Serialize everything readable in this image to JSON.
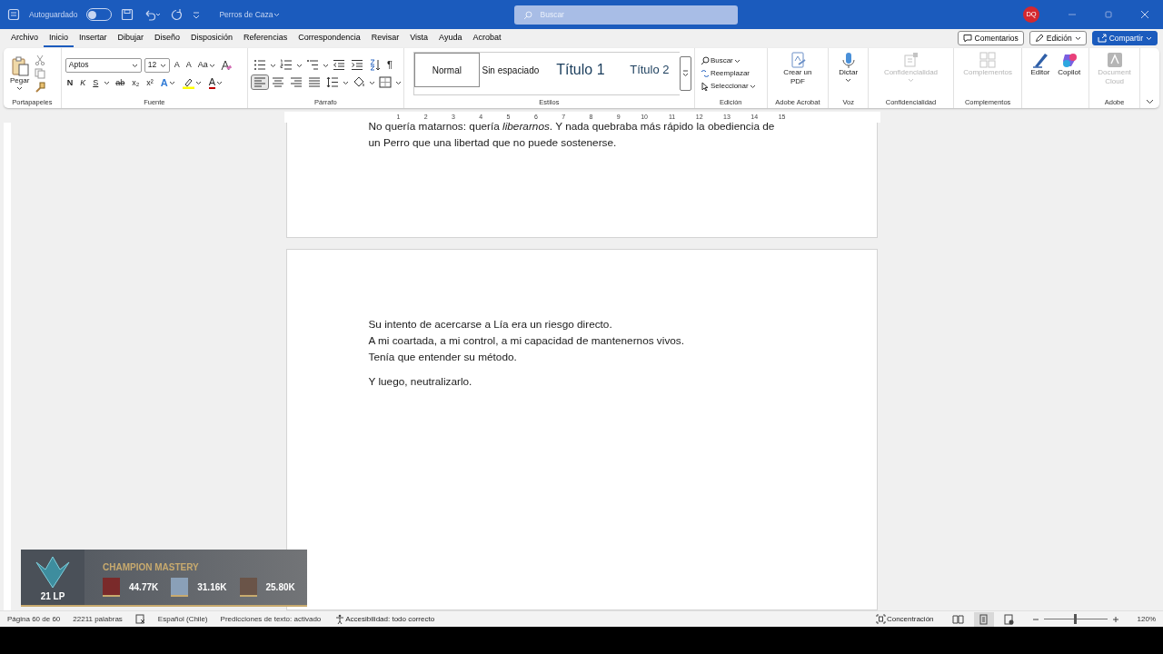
{
  "title_bar": {
    "autosave_label": "Autoguardado",
    "autosave_on": false,
    "document_title": "Perros de Caza",
    "search": {
      "placeholder": "Buscar"
    },
    "avatar": "DQ"
  },
  "menu_tabs": [
    {
      "label": "Archivo",
      "selected": false
    },
    {
      "label": "Inicio",
      "selected": true
    },
    {
      "label": "Insertar",
      "selected": false
    },
    {
      "label": "Dibujar",
      "selected": false
    },
    {
      "label": "Diseño",
      "selected": false
    },
    {
      "label": "Disposición",
      "selected": false
    },
    {
      "label": "Referencias",
      "selected": false
    },
    {
      "label": "Correspondencia",
      "selected": false
    },
    {
      "label": "Revisar",
      "selected": false
    },
    {
      "label": "Vista",
      "selected": false
    },
    {
      "label": "Ayuda",
      "selected": false
    },
    {
      "label": "Acrobat",
      "selected": false
    }
  ],
  "top_actions": [
    {
      "kind": "comments",
      "label": "Comentarios"
    },
    {
      "kind": "editing",
      "label": "Edición"
    },
    {
      "kind": "share",
      "label": "Compartir"
    }
  ],
  "ribbon": {
    "clipboard": {
      "label": "Portapapeles",
      "paste": "Pegar"
    },
    "font": {
      "label": "Fuente",
      "font_name": "Aptos",
      "font_size": "12",
      "size_tools": [
        "A",
        "A",
        "Aa"
      ],
      "format_buttons": [
        "N",
        "K",
        "S",
        "ab",
        "x₂",
        "x²"
      ],
      "text_effect": "A",
      "font_color": {
        "label": "A",
        "color": "#c00000"
      }
    },
    "paragraph": {
      "label": "Párrafo",
      "pilcrow": "¶",
      "alignments": [
        {
          "kind": "left",
          "selected": true
        },
        {
          "kind": "center",
          "selected": false
        },
        {
          "kind": "right",
          "selected": false
        },
        {
          "kind": "justify",
          "selected": false
        }
      ]
    },
    "styles": {
      "label": "Estilos",
      "items": [
        {
          "label": "Normal",
          "kind": "normal",
          "selected": true
        },
        {
          "label": "Sin espaciado",
          "kind": "normal",
          "selected": false
        },
        {
          "label": "Título 1",
          "kind": "heading1",
          "selected": false
        },
        {
          "label": "Título 2",
          "kind": "heading2",
          "selected": false
        }
      ]
    },
    "editing": {
      "label": "Edición",
      "items": [
        {
          "kind": "find",
          "label": "Buscar"
        },
        {
          "kind": "replace",
          "label": "Reemplazar"
        },
        {
          "kind": "select",
          "label": "Seleccionar"
        }
      ]
    },
    "groups": [
      {
        "kind": "pdf",
        "label": "Adobe Acrobat",
        "buttons": [
          {
            "label": "Crear un PDF",
            "disabled": false
          }
        ]
      },
      {
        "kind": "voice",
        "label": "Voz",
        "buttons": [
          {
            "label": "Dictar",
            "disabled": false
          }
        ]
      },
      {
        "kind": "sensitivity",
        "label": "Confidencialidad",
        "buttons": [
          {
            "label": "Confidencialidad",
            "disabled": true
          }
        ]
      },
      {
        "kind": "addins",
        "label": "Complementos",
        "buttons": [
          {
            "label": "Complementos",
            "disabled": true
          }
        ]
      },
      {
        "kind": "assist",
        "buttons": [
          {
            "label": "Editor",
            "disabled": false
          },
          {
            "label": "Copilot",
            "disabled": false
          }
        ]
      },
      {
        "kind": "adobe",
        "label": "Adobe",
        "buttons": [
          {
            "label": "Document Cloud",
            "disabled": true
          }
        ]
      }
    ]
  },
  "ruler_numbers": [
    "1",
    "2",
    "3",
    "4",
    "5",
    "6",
    "7",
    "8",
    "9",
    "10",
    "11",
    "12",
    "13",
    "14",
    "15"
  ],
  "pages": [
    {
      "paragraphs": [
        [
          "No quería matarnos: quería *liberarnos*. Y nada quebraba más rápido la obediencia de",
          "un Perro que una libertad que no puede sostenerse."
        ]
      ]
    },
    {
      "paragraphs": [
        [
          "Su intento de acercarse a Lía era un riesgo directo.",
          "A mi coartada, a mi control, a mi capacidad de mantenernos vivos.",
          "Tenía que entender su método."
        ],
        [
          "Y luego, neutralizarlo."
        ]
      ]
    }
  ],
  "overlay": {
    "title": "CHAMPION MASTERY",
    "rank": "21 LP",
    "champions": [
      "44.77K",
      "31.16K",
      "25.80K"
    ]
  },
  "status_bar": {
    "left": [
      {
        "kind": "text",
        "label": "Página 60 de 60"
      },
      {
        "kind": "text",
        "label": "22211 palabras"
      },
      {
        "kind": "proofing"
      },
      {
        "kind": "text",
        "label": "Español (Chile)"
      },
      {
        "kind": "text",
        "label": "Predicciones de texto: activado"
      },
      {
        "kind": "accessibility",
        "label": "Accesibilidad: todo correcto"
      }
    ],
    "focus": "Concentración",
    "views": [
      {
        "kind": "read",
        "selected": false
      },
      {
        "kind": "print",
        "selected": true
      },
      {
        "kind": "web",
        "selected": false
      }
    ],
    "zoom": {
      "level": 0.5,
      "label": "120%"
    }
  }
}
